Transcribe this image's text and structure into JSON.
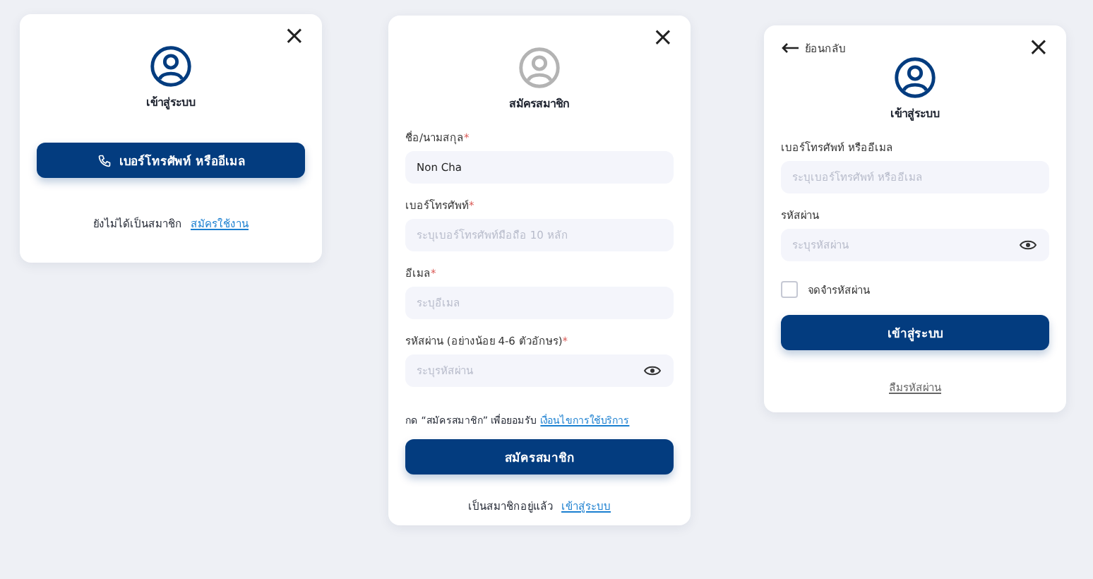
{
  "cards": [
    {
      "close": "×",
      "avatar_muted": false,
      "title": "เข้าสู่ระบบ",
      "items": [
        {
          "kind": "phone-button",
          "label": "เบอร์โทรศัพท์ หรืออีเมล"
        },
        {
          "kind": "footer",
          "text": "ยังไม่ได้เป็นสมาชิก",
          "link": "สมัครใช้งาน"
        }
      ]
    },
    {
      "close": "×",
      "avatar_muted": true,
      "title": "สมัครสมาชิก",
      "items": [
        {
          "kind": "field",
          "label": "ชื่อ/นามสกุล",
          "required_mark": "*",
          "value": "Non Cha"
        },
        {
          "kind": "field",
          "label": "เบอร์โทรศัพท์",
          "required_mark": "*",
          "placeholder": "ระบุเบอร์โทรศัพท์มือถือ 10 หลัก"
        },
        {
          "kind": "field",
          "label": "อีเมล",
          "required_mark": "*",
          "placeholder": "ระบุอีเมล"
        },
        {
          "kind": "password",
          "label": "รหัสผ่าน (อย่างน้อย 4-6 ตัวอักษร)",
          "required_mark": "*",
          "placeholder": "ระบุรหัสผ่าน"
        },
        {
          "kind": "consent",
          "text": "กด “สมัครสมาชิก” เพื่อยอมรับ",
          "link": "เงื่อนไขการใช้บริการ"
        },
        {
          "kind": "button",
          "label": "สมัครสมาชิก"
        },
        {
          "kind": "footer",
          "text": "เป็นสมาชิกอยู่แล้ว",
          "link": "เข้าสู่ระบบ"
        }
      ]
    },
    {
      "back": "ย้อนกลับ",
      "close": "×",
      "avatar_muted": false,
      "title": "เข้าสู่ระบบ",
      "items": [
        {
          "kind": "field",
          "label": "เบอร์โทรศัพท์ หรืออีเมล",
          "placeholder": "ระบุเบอร์โทรศัพท์ หรืออีเมล"
        },
        {
          "kind": "password",
          "label": "รหัสผ่าน",
          "placeholder": "ระบุรหัสผ่าน"
        },
        {
          "kind": "checkbox",
          "label": "จดจำรหัสผ่าน",
          "checked": false
        },
        {
          "kind": "button",
          "label": "เข้าสู่ระบบ"
        },
        {
          "kind": "link",
          "text": "ลืมรหัสผ่าน"
        }
      ]
    }
  ]
}
